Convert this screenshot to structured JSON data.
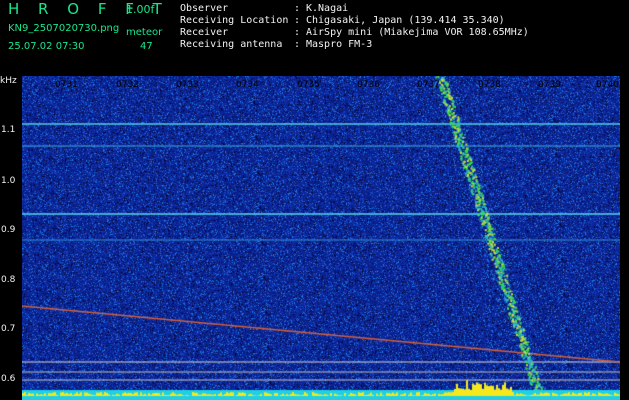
{
  "header": {
    "app_name": "H R O F F T",
    "version": "1.00f",
    "filename": "KN9_2507020730.png",
    "meteor_label": "meteor",
    "datetime": "25.07.02 07:30",
    "meteor_count": "47"
  },
  "info": [
    {
      "label": "Observer",
      "value": "K.Nagai"
    },
    {
      "label": "Receiving Location",
      "value": "Chigasaki, Japan (139.414 35.340)"
    },
    {
      "label": "Receiver",
      "value": "AirSpy mini (Miakejima VOR 108.65MHz)"
    },
    {
      "label": "Receiving antenna",
      "value": "Maspro FM-3"
    }
  ],
  "info_separator": ":",
  "time_axis": {
    "labels": [
      "0731",
      "0732",
      "0733",
      "0734",
      "0735",
      "0736",
      "0737",
      "0738",
      "0739",
      "0740"
    ]
  },
  "freq_axis": {
    "unit": "kHz",
    "labels": [
      "1.1",
      "1.0",
      "0.9",
      "0.8",
      "0.7",
      "0.6"
    ]
  },
  "colors": {
    "background_noise": "#1a2fa8",
    "trace": "#2de03c",
    "header_green": "#19e68c",
    "header_white": "#f2f2f2",
    "bottom_band": "#1ecfe6",
    "bottom_burst": "#f5e81c"
  }
}
